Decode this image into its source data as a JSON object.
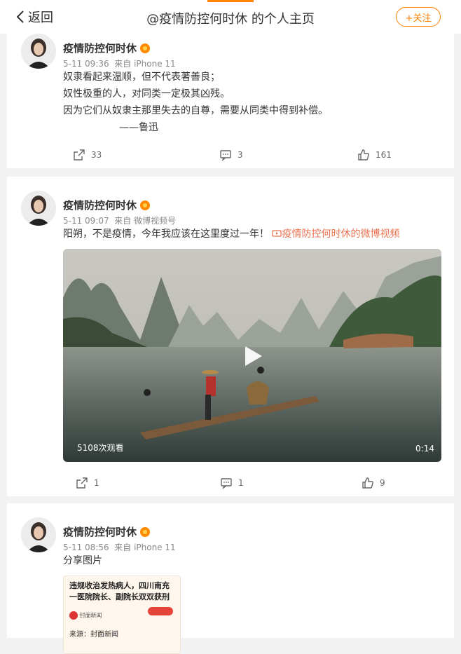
{
  "header": {
    "back_label": "返回",
    "title": "@疫情防控何时休 的个人主页",
    "follow_label": "+关注"
  },
  "posts": [
    {
      "user": "疫情防控何时休",
      "time": "5-11 09:36",
      "source": "来自 iPhone 11",
      "lines": [
        "奴隶看起来温顺，但不代表著善良；",
        "奴性极重的人，对同类一定极其凶残。",
        "因为它们从奴隶主那里失去的自尊，需要从同类中得到补偿。",
        "——鲁迅"
      ],
      "reposts": "33",
      "comments": "3",
      "likes": "161"
    },
    {
      "user": "疫情防控何时休",
      "time": "5-11 09:07",
      "source": "来自 微博视频号",
      "text": "阳朔，不是疫情，今年我应该在这里度过一年！",
      "video_link": "疫情防控何时休的微博视频",
      "video_views": "5108次观看",
      "video_duration": "0:14",
      "reposts": "1",
      "comments": "1",
      "likes": "9"
    },
    {
      "user": "疫情防控何时休",
      "time": "5-11 08:56",
      "source": "来自 iPhone 11",
      "text": "分享图片",
      "image_headline": "违规收治发热病人，四川南充一医院院长、副院长双双获刑",
      "image_outlet": "封面新闻",
      "image_from": "来源：封面新闻"
    }
  ],
  "colors": {
    "accent": "#ff8200",
    "link": "#eb7350",
    "background": "#f2f2f2"
  }
}
